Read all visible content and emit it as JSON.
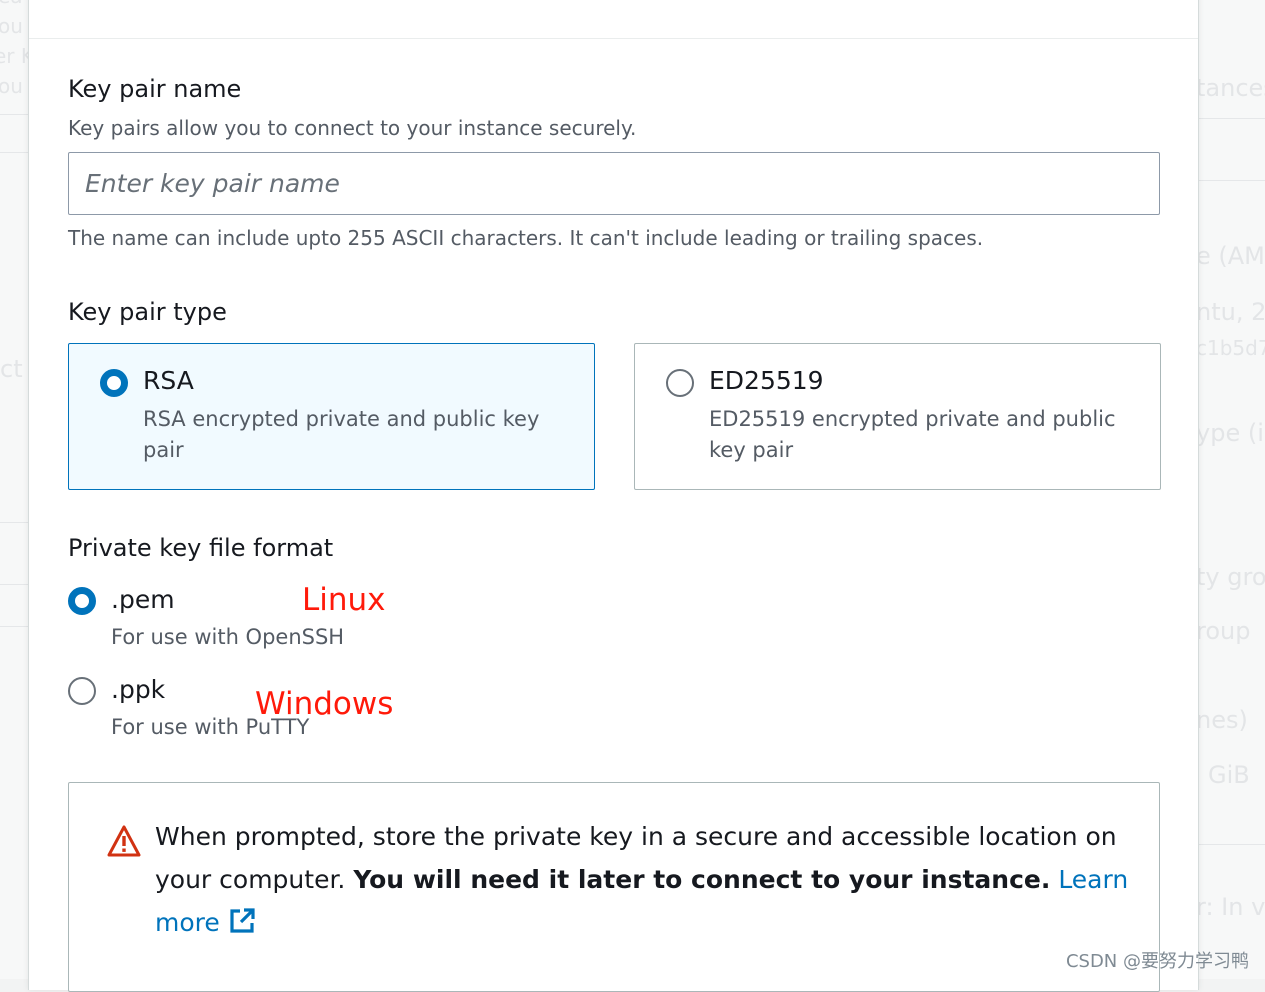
{
  "background": {
    "left_fragments": [
      "ea",
      "ou",
      "er K",
      "ou",
      "ct"
    ],
    "right_fragments": [
      "tances",
      "e (AM",
      "ntu, 2",
      "c1b5d7",
      "ype (i",
      "ty gro",
      "roup",
      "nes)",
      "GiB",
      "r: In v"
    ]
  },
  "key_pair_name": {
    "label": "Key pair name",
    "description": "Key pairs allow you to connect to your instance securely.",
    "placeholder": "Enter key pair name",
    "value": "",
    "constraint": "The name can include upto 255 ASCII characters. It can't include leading or trailing spaces."
  },
  "key_pair_type": {
    "label": "Key pair type",
    "selected": "RSA",
    "options": [
      {
        "title": "RSA",
        "description": "RSA encrypted private and public key pair"
      },
      {
        "title": "ED25519",
        "description": "ED25519 encrypted private and public key pair"
      }
    ]
  },
  "private_key_format": {
    "label": "Private key file format",
    "selected": ".pem",
    "options": [
      {
        "title": ".pem",
        "description": "For use with OpenSSH",
        "annotation": "Linux"
      },
      {
        "title": ".ppk",
        "description": "For use with PuTTY",
        "annotation": "Windows"
      }
    ]
  },
  "alert": {
    "icon": "warning-icon",
    "text_before": "When prompted, store the private key in a secure and accessible location on your computer. ",
    "text_bold": "You will need it later to connect to your instance.",
    "link_text": "Learn more",
    "link_icon": "external-link-icon"
  },
  "watermark": "CSDN @要努力学习鸭",
  "colors": {
    "accent": "#0073bb",
    "selected_tile_bg": "#f1faff",
    "warning": "#d13212",
    "annotation": "#ff1a0a"
  }
}
